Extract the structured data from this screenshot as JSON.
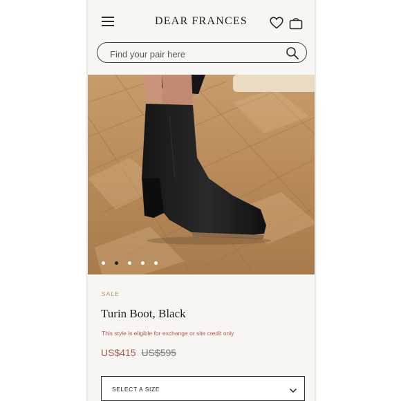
{
  "header": {
    "brand": "DEAR FRANCES",
    "icons": [
      "menu-icon",
      "heart-icon",
      "shopping-bag-icon"
    ]
  },
  "search": {
    "placeholder": "Find your pair here",
    "icon": "search-icon"
  },
  "gallery": {
    "image": "black leather ankle boot on parquet floor",
    "slide_count": 5,
    "active_index": 1
  },
  "product": {
    "badge": "SALE",
    "name": "Turin Boot, Black",
    "policy_note": "This style is eligible for exchange or site credit only",
    "price_sale": "US$415",
    "price_original": "US$595"
  },
  "size_selector": {
    "label": "SELECT A SIZE"
  },
  "colors": {
    "background": "#f7f6f3",
    "sale_badge": "#b5955c",
    "sale_price": "#b05555"
  }
}
